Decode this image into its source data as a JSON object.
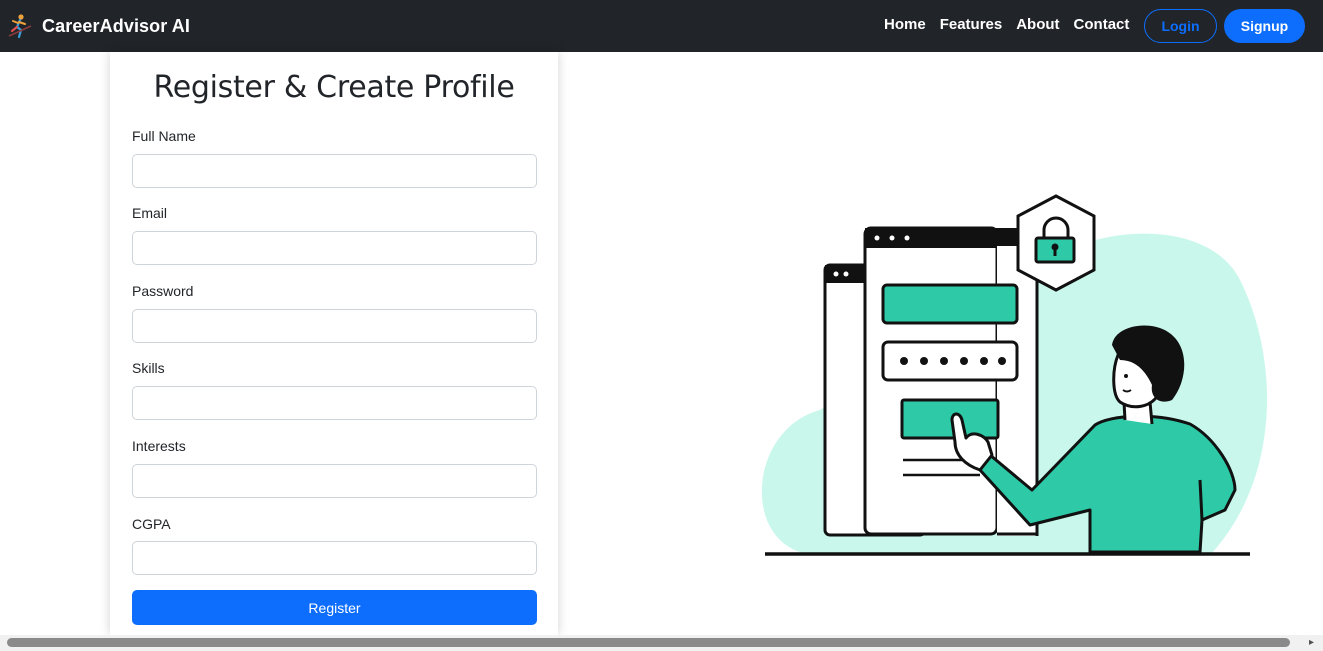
{
  "navbar": {
    "brand": "CareerAdvisor AI",
    "links": [
      "Home",
      "Features",
      "About",
      "Contact"
    ],
    "login_label": "Login",
    "signup_label": "Signup"
  },
  "form": {
    "title": "Register & Create Profile",
    "fields": [
      {
        "label": "Full Name",
        "value": "",
        "placeholder": ""
      },
      {
        "label": "Email",
        "value": "",
        "placeholder": ""
      },
      {
        "label": "Password",
        "value": "",
        "placeholder": ""
      },
      {
        "label": "Skills",
        "value": "",
        "placeholder": ""
      },
      {
        "label": "Interests",
        "value": "",
        "placeholder": ""
      },
      {
        "label": "CGPA",
        "value": "",
        "placeholder": ""
      }
    ],
    "submit_label": "Register"
  },
  "colors": {
    "navbar_bg": "#212529",
    "primary": "#0d6efd",
    "illustration_accent": "#2ec9a7",
    "illustration_blob": "#c9f7ec"
  },
  "icons": {
    "brand_logo": "career-runner-icon",
    "illustration": "secure-login-illustration",
    "scroll_left": "arrow-left-icon",
    "scroll_right": "arrow-right-icon"
  }
}
